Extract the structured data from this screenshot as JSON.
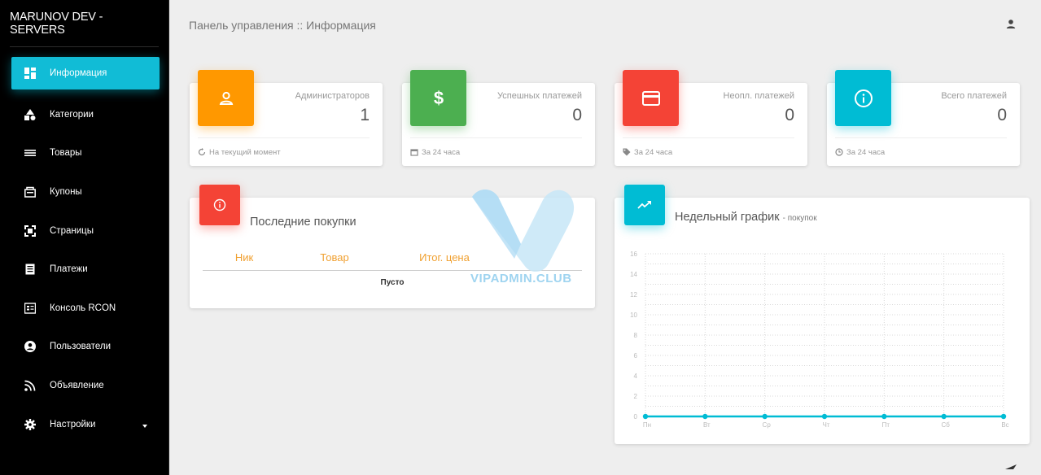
{
  "sidebar": {
    "brand": "MARUNOV DEV - SERVERS",
    "items": [
      {
        "label": "Информация",
        "icon": "dashboard-icon",
        "active": true
      },
      {
        "label": "Категории",
        "icon": "shapes-icon"
      },
      {
        "label": "Товары",
        "icon": "list-icon"
      },
      {
        "label": "Купоны",
        "icon": "coupon-icon"
      },
      {
        "label": "Страницы",
        "icon": "pages-icon"
      },
      {
        "label": "Платежи",
        "icon": "receipt-icon"
      },
      {
        "label": "Консоль RCON",
        "icon": "console-icon"
      },
      {
        "label": "Пользователи",
        "icon": "account-icon"
      },
      {
        "label": "Объявление",
        "icon": "rss-icon"
      },
      {
        "label": "Настройки",
        "icon": "gear-icon"
      }
    ]
  },
  "header": {
    "breadcrumb": "Панель управления :: Информация",
    "user_icon": "user-icon"
  },
  "stats": [
    {
      "label": "Администраторов",
      "value": "1",
      "footer": "На текущий момент",
      "color": "#ff9800",
      "icon": "person-icon",
      "footer_icon": "refresh-icon"
    },
    {
      "label": "Успешных платежей",
      "value": "0",
      "footer": "За 24 часа",
      "color": "#4caf50",
      "icon": "dollar-icon",
      "footer_icon": "calendar-icon"
    },
    {
      "label": "Неопл. платежей",
      "value": "0",
      "footer": "За 24 часа",
      "color": "#f44336",
      "icon": "card-icon",
      "footer_icon": "tag-icon"
    },
    {
      "label": "Всего платежей",
      "value": "0",
      "footer": "За 24 часа",
      "color": "#00bcd4",
      "icon": "info-icon",
      "footer_icon": "clock-icon"
    }
  ],
  "purchases": {
    "title": "Последние покупки",
    "columns": [
      "Ник",
      "Товар",
      "Итог. цена"
    ],
    "empty_text": "Пусто",
    "color": "#f44336"
  },
  "weekly": {
    "title": "Недельный график",
    "subtitle": "- покупок",
    "color": "#00bcd4"
  },
  "watermark": "VIPADMIN.CLUB",
  "chart_data": {
    "type": "line",
    "categories": [
      "Пн",
      "Вт",
      "Ср",
      "Чт",
      "Пт",
      "Сб",
      "Вс"
    ],
    "series": [
      {
        "values": [
          0,
          0,
          0,
          0,
          0,
          0,
          0
        ],
        "color": "#00bcd4"
      }
    ],
    "ylim": [
      0,
      16
    ],
    "yticks": [
      0,
      2,
      4,
      6,
      8,
      10,
      12,
      14,
      16
    ],
    "grid": true
  }
}
